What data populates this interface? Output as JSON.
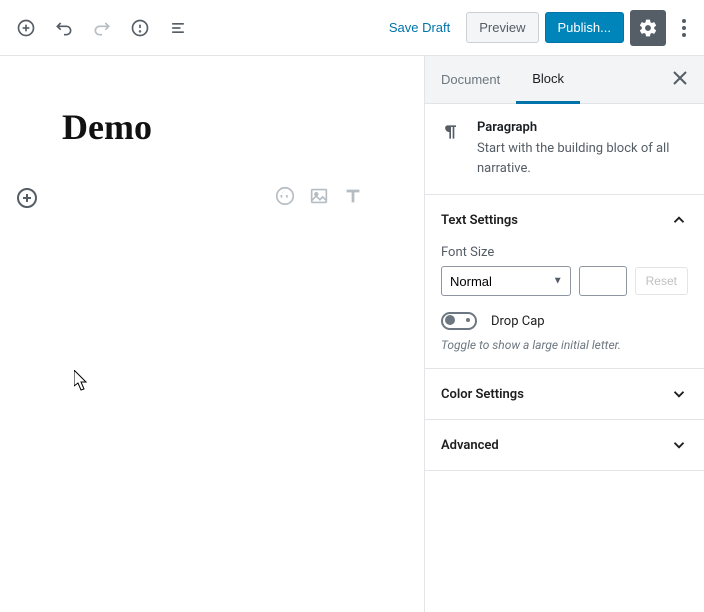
{
  "toolbar": {
    "save_draft": "Save Draft",
    "preview": "Preview",
    "publish": "Publish..."
  },
  "editor": {
    "title": "Demo"
  },
  "sidebar": {
    "tabs": {
      "document": "Document",
      "block": "Block"
    },
    "block_info": {
      "name": "Paragraph",
      "desc": "Start with the building block of all narrative."
    },
    "panels": {
      "text_settings": {
        "title": "Text Settings",
        "font_size_label": "Font Size",
        "font_size_value": "Normal",
        "reset": "Reset",
        "drop_cap_label": "Drop Cap",
        "drop_cap_help": "Toggle to show a large initial letter."
      },
      "color_settings": {
        "title": "Color Settings"
      },
      "advanced": {
        "title": "Advanced"
      }
    }
  }
}
